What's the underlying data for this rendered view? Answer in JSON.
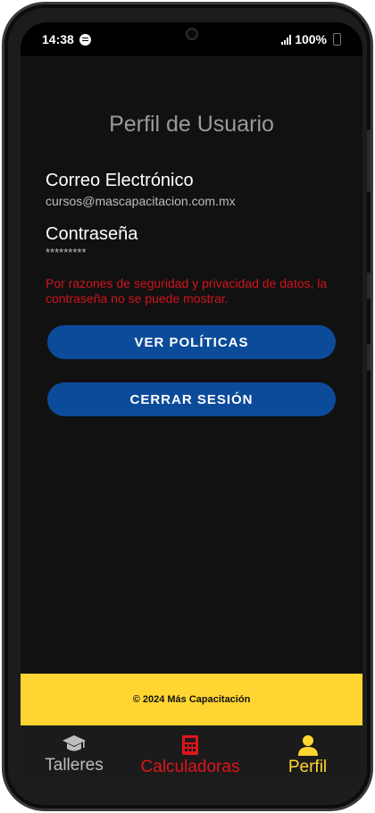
{
  "status_bar": {
    "time": "14:38",
    "battery": "100%"
  },
  "profile": {
    "title": "Perfil de Usuario",
    "email_label": "Correo Electrónico",
    "email_value": "cursos@mascapacitacion.com.mx",
    "password_label": "Contraseña",
    "password_value": "*********",
    "security_note": "Por razones de seguridad y privacidad de datos, la contraseña no se puede mostrar."
  },
  "buttons": {
    "policies_label": "VER POLÍTICAS",
    "logout_label": "CERRAR SESIÓN"
  },
  "footer": {
    "text": "© 2024 Más Capacitación"
  },
  "bottom_nav": {
    "items": [
      {
        "label": "Talleres",
        "icon": "graduation-cap-icon",
        "color": "#bdbdbd"
      },
      {
        "label": "Calculadoras",
        "icon": "calculator-icon",
        "color": "#e0141c"
      },
      {
        "label": "Perfil",
        "icon": "user-icon",
        "color": "#ffd532",
        "active": true
      }
    ]
  },
  "colors": {
    "accent_blue": "#0c4b9a",
    "brand_yellow": "#ffd532",
    "warning_red": "#d0141c",
    "background": "#111111"
  }
}
